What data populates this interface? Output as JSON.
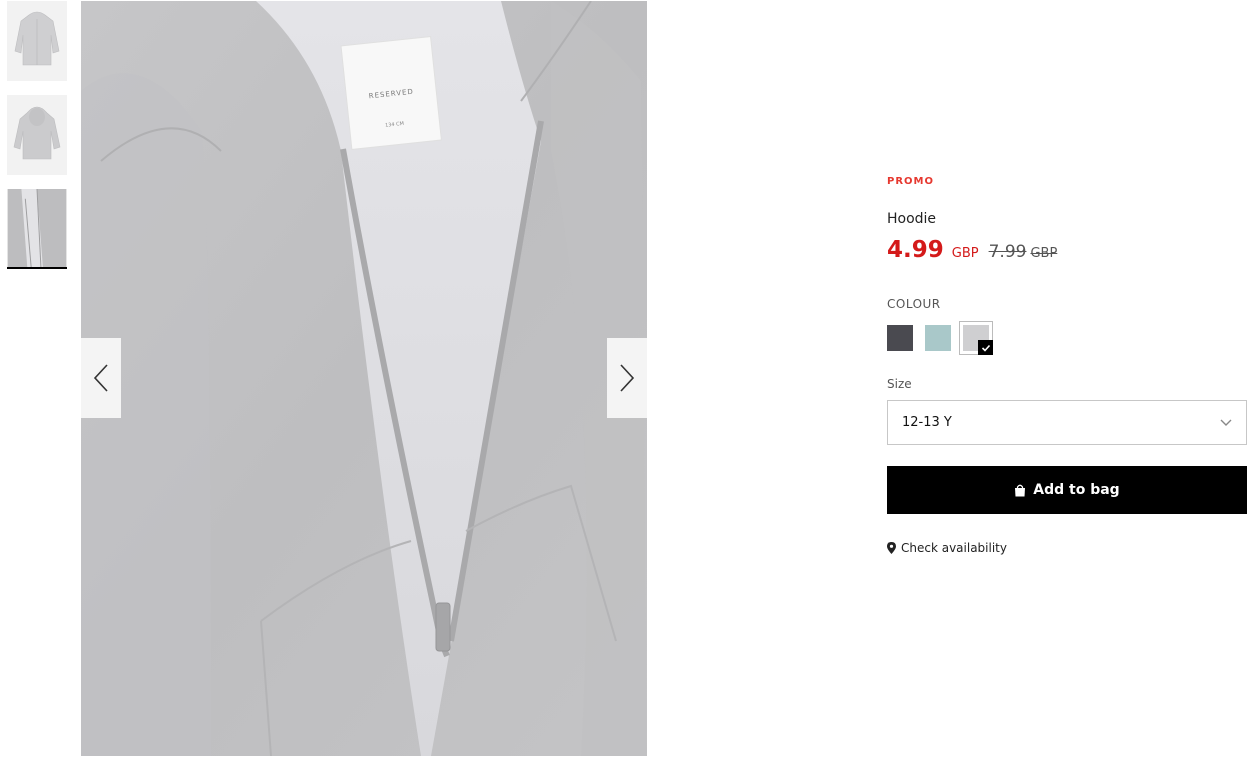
{
  "thumbnails": [
    {
      "label": "hoodie-front"
    },
    {
      "label": "hoodie-back"
    },
    {
      "label": "hoodie-detail"
    }
  ],
  "product": {
    "badge": "PROMO",
    "name": "Hoodie",
    "price_new": "4.99",
    "price_new_currency": "GBP",
    "price_old": "7.99",
    "price_old_currency": "GBP",
    "label_text": "RESERVED",
    "label_size": "134 CM"
  },
  "colour": {
    "label": "COLOUR",
    "options": [
      {
        "name": "dark-grey",
        "hex": "#4a4a50"
      },
      {
        "name": "mint",
        "hex": "#a9c8c9"
      },
      {
        "name": "light-grey",
        "hex": "#cfcfd1",
        "selected": true
      }
    ]
  },
  "size": {
    "label": "Size",
    "selected": "12-13 Y"
  },
  "actions": {
    "add_to_bag": "Add to bag",
    "check_availability": "Check availability"
  },
  "colors": {
    "promo": "#e6382f",
    "price": "#d41a1a",
    "button_bg": "#000000"
  }
}
